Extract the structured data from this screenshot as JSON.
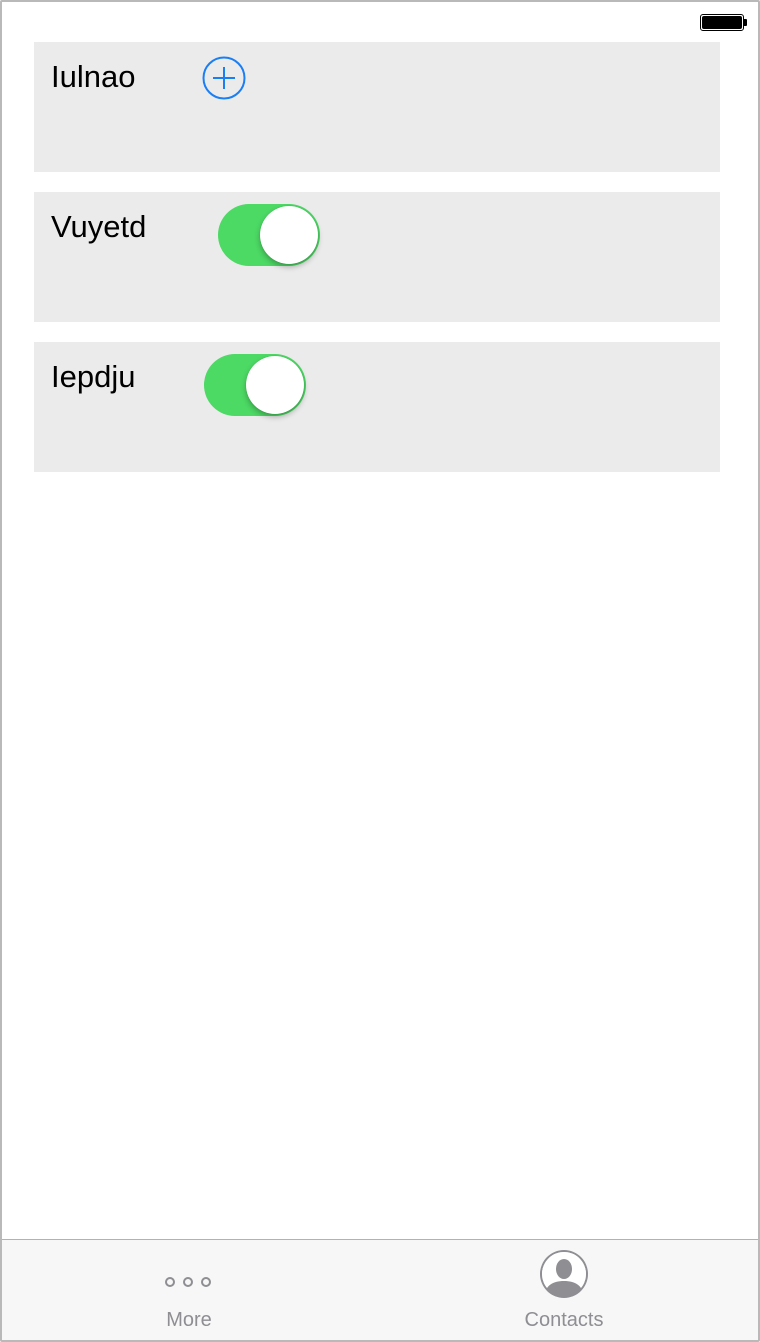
{
  "status_bar": {
    "battery_icon": "battery-full-icon"
  },
  "rows": [
    {
      "label": "Iulnao",
      "control": "add-button",
      "icon": "plus-circle-icon",
      "accent": "#1a7ef5"
    },
    {
      "label": "Vuyetd",
      "control": "toggle",
      "state": "on",
      "accent": "#4cd964"
    },
    {
      "label": "Iepdju",
      "control": "toggle",
      "state": "on",
      "accent": "#4cd964"
    }
  ],
  "tab_bar": {
    "tabs": [
      {
        "label": "More",
        "icon": "more-dots-icon"
      },
      {
        "label": "Contacts",
        "icon": "contact-person-icon"
      }
    ],
    "inactive_color": "#8e8e93"
  }
}
